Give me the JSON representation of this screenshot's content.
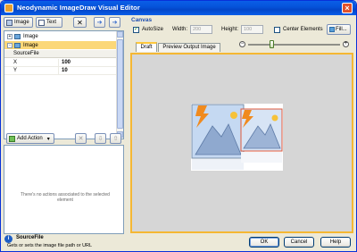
{
  "window": {
    "title": "Neodynamic ImageDraw Visual Editor",
    "close_glyph": "×"
  },
  "left_toolbar": {
    "image_label": "Image",
    "text_label": "Text",
    "delete_glyph": "✕",
    "move_down_glyph": "➔",
    "move_up_glyph": "➔"
  },
  "tree": {
    "items": [
      {
        "label": "Image",
        "expander": "+"
      },
      {
        "label": "Image",
        "expander": "-"
      }
    ]
  },
  "properties": {
    "header": "SourceFile",
    "rows": [
      {
        "key": "X",
        "value": "100"
      },
      {
        "key": "Y",
        "value": "10"
      }
    ]
  },
  "actions": {
    "add_action_label": "Add Action",
    "dropdown_glyph": "▾",
    "delete_glyph": "✕",
    "move_down_glyph": "⇩",
    "move_up_glyph": "⇧",
    "empty_message": "There's no actions associated to the selected element"
  },
  "canvas": {
    "title": "Canvas",
    "autosize_label": "AutoSize",
    "autosize_checked": true,
    "width_label": "Width:",
    "width_value": "200",
    "height_label": "Height:",
    "height_value": "100",
    "center_elements_label": "Center Elements",
    "center_elements_checked": false,
    "fill_label": "Fill...",
    "tabs": [
      {
        "label": "Draft",
        "active": true
      },
      {
        "label": "Preview Output Image",
        "active": false
      }
    ],
    "zoom_minus": "−",
    "zoom_plus": "+",
    "zoom_level": 0.25
  },
  "footer": {
    "info_title": "SourceFile",
    "info_desc": "Gets or sets the image file path or URL",
    "ok_label": "OK",
    "cancel_label": "Cancel",
    "help_label": "Help"
  },
  "icons": {
    "app": "app-icon",
    "info": "info-icon",
    "image_thumb": "image-thumbnail-icon"
  },
  "colors": {
    "titlebar": "#0552d8",
    "selection": "#fbd778",
    "canvas_border": "#f5b733",
    "canvas_bg": "#d6d6d6",
    "accent_title": "#1f4fb0"
  }
}
